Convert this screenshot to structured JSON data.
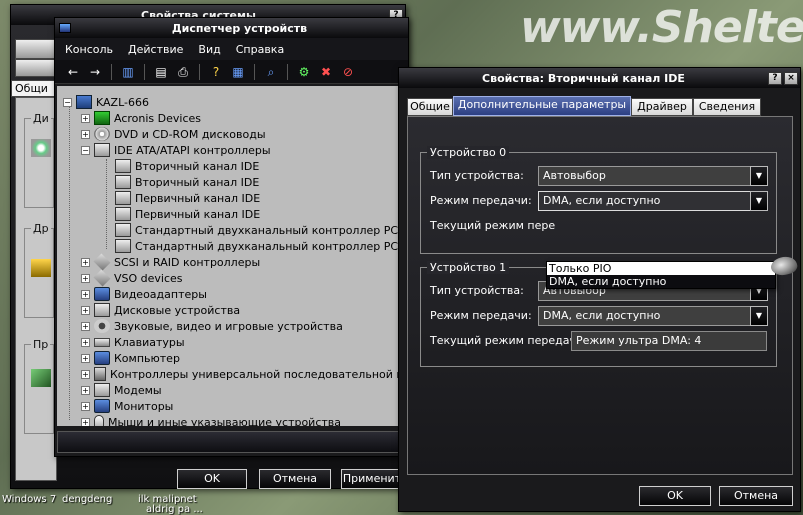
{
  "desktop": {
    "logo_text": "www.Shelter",
    "taskbar_texts": [
      "Windows 7",
      "dengdeng",
      "ilk malipnet",
      "aldrig pa ..."
    ]
  },
  "sysprops": {
    "title": "Свойства системы",
    "tab_visible": "Общи",
    "group_labels": [
      "Ди",
      "Др",
      "Пр"
    ],
    "buttons": {
      "ok": "OK",
      "cancel": "Отмена",
      "apply": "Применит"
    },
    "help_btn": "?"
  },
  "devmgr": {
    "title": "Диспетчер устройств",
    "menu": [
      "Консоль",
      "Действие",
      "Вид",
      "Справка"
    ],
    "tree": [
      {
        "label": "KAZL-666",
        "level": 0,
        "exp": "−",
        "icon": "computer-icon"
      },
      {
        "label": "Acronis Devices",
        "level": 1,
        "exp": "+",
        "icon": "card-icon"
      },
      {
        "label": "DVD и CD-ROM дисководы",
        "level": 1,
        "exp": "+",
        "icon": "disc-icon"
      },
      {
        "label": "IDE ATA/ATAPI контроллеры",
        "level": 1,
        "exp": "−",
        "icon": "ide-controller-icon"
      },
      {
        "label": "Вторичный канал IDE",
        "level": 2,
        "exp": "",
        "icon": "ide-channel-icon"
      },
      {
        "label": "Вторичный канал IDE",
        "level": 2,
        "exp": "",
        "icon": "ide-channel-icon"
      },
      {
        "label": "Первичный канал IDE",
        "level": 2,
        "exp": "",
        "icon": "ide-channel-icon"
      },
      {
        "label": "Первичный канал IDE",
        "level": 2,
        "exp": "",
        "icon": "ide-channel-icon"
      },
      {
        "label": "Стандартный двухканальный контроллер PCI IDE",
        "level": 2,
        "exp": "",
        "icon": "ide-channel-icon"
      },
      {
        "label": "Стандартный двухканальный контроллер PCI IDE",
        "level": 2,
        "exp": "",
        "icon": "ide-channel-icon"
      },
      {
        "label": "SCSI и RAID контроллеры",
        "level": 1,
        "exp": "+",
        "icon": "scsi-icon"
      },
      {
        "label": "VSO devices",
        "level": 1,
        "exp": "+",
        "icon": "vso-icon"
      },
      {
        "label": "Видеоадаптеры",
        "level": 1,
        "exp": "+",
        "icon": "display-adapter-icon"
      },
      {
        "label": "Дисковые устройства",
        "level": 1,
        "exp": "+",
        "icon": "disk-drive-icon"
      },
      {
        "label": "Звуковые, видео и игровые устройства",
        "level": 1,
        "exp": "+",
        "icon": "sound-icon"
      },
      {
        "label": "Клавиатуры",
        "level": 1,
        "exp": "+",
        "icon": "keyboard-icon"
      },
      {
        "label": "Компьютер",
        "level": 1,
        "exp": "+",
        "icon": "pc-icon"
      },
      {
        "label": "Контроллеры универсальной последовательной шины",
        "level": 1,
        "exp": "+",
        "icon": "usb-icon"
      },
      {
        "label": "Модемы",
        "level": 1,
        "exp": "+",
        "icon": "modem-icon"
      },
      {
        "label": "Мониторы",
        "level": 1,
        "exp": "+",
        "icon": "monitor-icon"
      },
      {
        "label": "Мыши и иные указывающие устройства",
        "level": 1,
        "exp": "+",
        "icon": "mouse-icon"
      }
    ]
  },
  "ideprops": {
    "title": "Свойства: Вторичный канал IDE",
    "help_btn": "?",
    "close_btn": "×",
    "tabs": [
      "Общие",
      "Дополнительные параметры",
      "Драйвер",
      "Сведения"
    ],
    "device0": {
      "group": "Устройство 0",
      "type_label": "Тип устройства:",
      "type_value": "Автовыбор",
      "mode_label": "Режим передачи:",
      "mode_value": "DMA, если доступно",
      "current_label": "Текущий режим пере",
      "dropdown_options": [
        "Только PIO",
        "DMA, если доступно"
      ]
    },
    "device1": {
      "group": "Устройство 1",
      "type_label": "Тип устройства:",
      "type_value": "Автовыбор",
      "mode_label": "Режим передачи:",
      "mode_value": "DMA, если доступно",
      "current_label": "Текущий режим передачи:",
      "current_value": "Режим ультра DMA: 4"
    },
    "buttons": {
      "ok": "OK",
      "cancel": "Отмена"
    }
  }
}
